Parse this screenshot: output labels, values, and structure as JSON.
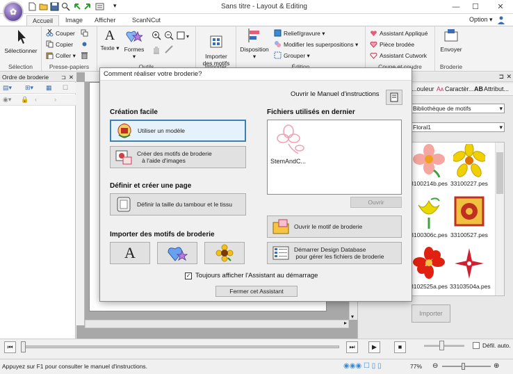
{
  "window": {
    "title": "Sans titre - Layout & Editing",
    "minimize": "—",
    "maximize": "☐",
    "close": "✕"
  },
  "ribbon": {
    "tabs": [
      "Accueil",
      "Image",
      "Afficher",
      "ScanNCut"
    ],
    "option_label": "Option",
    "groups": {
      "selection": {
        "label": "Sélection",
        "button": "Sélectionner"
      },
      "clipboard": {
        "label": "Presse-papiers",
        "cut": "Couper",
        "copy": "Copier",
        "paste": "Coller"
      },
      "tools": {
        "label": "Outils",
        "text": "Texte",
        "shapes": "Formes"
      },
      "import": {
        "label": "Importer",
        "button": "Importer\ndes motifs"
      },
      "edition": {
        "label": "Édition",
        "layout": "Disposition",
        "relief": "Relief/gravure",
        "overlaps": "Modifier les superpositions",
        "group": "Grouper"
      },
      "cut": {
        "label": "Coupe et coudre",
        "applique": "Assistant Appliqué",
        "patch": "Pièce brodée",
        "cutwork": "Assistant Cutwork"
      },
      "embroidery": {
        "label": "Broderie",
        "send": "Envoyer"
      }
    }
  },
  "left_panel": {
    "title": "Ordre de broderie"
  },
  "right_panel": {
    "tabs": [
      "...ouleur",
      "Caractèr...",
      "Attribut..."
    ],
    "library": "Bibliothèque de motifs",
    "category": "Floral1",
    "thumbnails": [
      {
        "name": "3100214b.pes",
        "color": "#f6a6a0"
      },
      {
        "name": "33100227.pes",
        "color": "#f0d000"
      },
      {
        "name": "3100306c.pes",
        "color": "#e8d800"
      },
      {
        "name": "33100527.pes",
        "color": "#c03020"
      },
      {
        "name": "3102525a.pes",
        "color": "#e02010"
      },
      {
        "name": "33103504a.pes",
        "color": "#d02030"
      }
    ],
    "import_button": "Importer"
  },
  "playback": {
    "auto_scroll_label": "Défil. auto."
  },
  "statusbar": {
    "message": "Appuyez sur F1 pour consulter le manuel d'instructions.",
    "zoom": "77%"
  },
  "dialog": {
    "title": "Comment réaliser votre broderie?",
    "manual_link": "Ouvrir le Manuel d'instructions",
    "easy_heading": "Création facile",
    "use_template": "Utiliser un modèle",
    "create_from_image_line1": "Créer des motifs de broderie",
    "create_from_image_line2": "à l'aide d'images",
    "define_heading": "Définir et créer une page",
    "hoop_size": "Définir la taille du tambour et le tissu",
    "import_heading": "Importer des motifs de broderie",
    "recent_heading": "Fichiers utilisés en dernier",
    "recent_file": "StemAndC...",
    "open_button": "Ouvrir",
    "open_design": "Ouvrir le motif de broderie",
    "database_line1": "Démarrer Design Database",
    "database_line2": "pour gérer les fichiers de broderie",
    "always_show": "Toujours afficher l'Assistant au démarrage",
    "close_button": "Fermer cet Assistant"
  }
}
